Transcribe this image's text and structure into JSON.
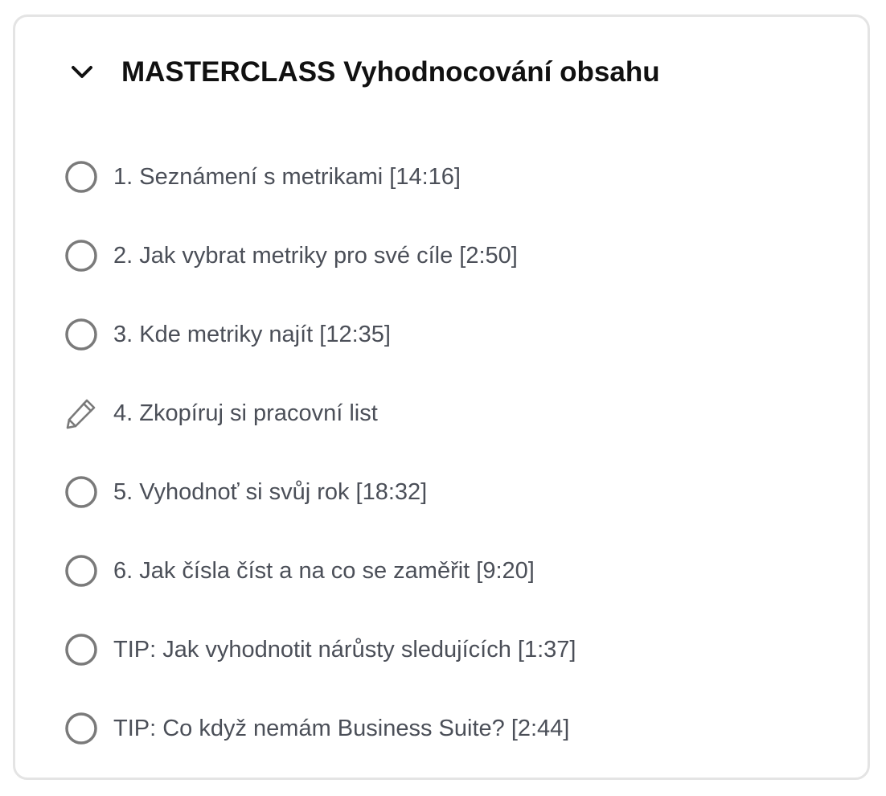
{
  "section": {
    "title": "MASTERCLASS Vyhodnocování obsahu",
    "expanded": true,
    "chevron_icon": "chevron-down-icon"
  },
  "lessons": [
    {
      "label": "1. Seznámení s metrikami [14:16]",
      "icon": "circle-icon"
    },
    {
      "label": "2. Jak vybrat metriky pro své cíle [2:50]",
      "icon": "circle-icon"
    },
    {
      "label": "3. Kde metriky najít [12:35]",
      "icon": "circle-icon"
    },
    {
      "label": "4. Zkopíruj si pracovní list",
      "icon": "pencil-icon"
    },
    {
      "label": "5. Vyhodnoť si svůj rok [18:32]",
      "icon": "circle-icon"
    },
    {
      "label": "6. Jak čísla číst a na co se zaměřit [9:20]",
      "icon": "circle-icon"
    },
    {
      "label": "TIP: Jak vyhodnotit nárůsty sledujících [1:37]",
      "icon": "circle-icon"
    },
    {
      "label": "TIP: Co když nemám Business Suite? [2:44]",
      "icon": "circle-icon"
    }
  ],
  "colors": {
    "title": "#111111",
    "label": "#4b4f58",
    "icon": "#7a7a7a",
    "border": "#e4e4e4"
  }
}
